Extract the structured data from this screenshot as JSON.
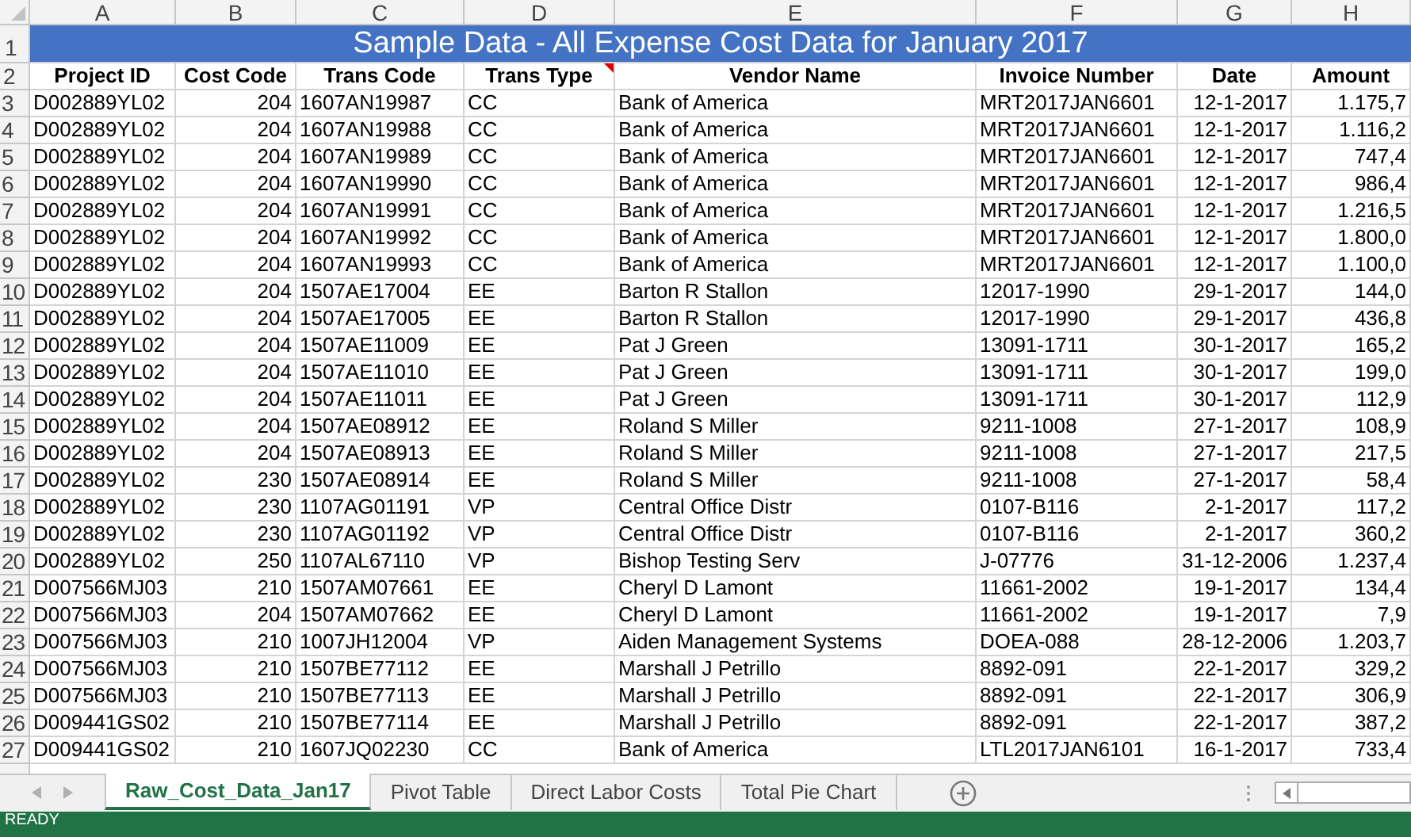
{
  "columns": [
    {
      "letter": "A",
      "heading": "Project ID",
      "comment": false
    },
    {
      "letter": "B",
      "heading": "Cost Code",
      "comment": false
    },
    {
      "letter": "C",
      "heading": "Trans Code",
      "comment": false
    },
    {
      "letter": "D",
      "heading": "Trans Type",
      "comment": true
    },
    {
      "letter": "E",
      "heading": "Vendor Name",
      "comment": false
    },
    {
      "letter": "F",
      "heading": "Invoice Number",
      "comment": false
    },
    {
      "letter": "G",
      "heading": "Date",
      "comment": false
    },
    {
      "letter": "H",
      "heading": "Amount",
      "comment": false
    }
  ],
  "title_row": {
    "number": "1",
    "title": "Sample Data - All Expense Cost Data for January 2017"
  },
  "heading_row_number": "2",
  "rows": [
    {
      "number": "3",
      "cells": [
        "D002889YL02",
        "204",
        "1607AN19987",
        "CC",
        "Bank of America",
        "MRT2017JAN6601",
        "12-1-2017",
        "1.175,7"
      ]
    },
    {
      "number": "4",
      "cells": [
        "D002889YL02",
        "204",
        "1607AN19988",
        "CC",
        "Bank of America",
        "MRT2017JAN6601",
        "12-1-2017",
        "1.116,2"
      ]
    },
    {
      "number": "5",
      "cells": [
        "D002889YL02",
        "204",
        "1607AN19989",
        "CC",
        "Bank of America",
        "MRT2017JAN6601",
        "12-1-2017",
        "747,4"
      ]
    },
    {
      "number": "6",
      "cells": [
        "D002889YL02",
        "204",
        "1607AN19990",
        "CC",
        "Bank of America",
        "MRT2017JAN6601",
        "12-1-2017",
        "986,4"
      ]
    },
    {
      "number": "7",
      "cells": [
        "D002889YL02",
        "204",
        "1607AN19991",
        "CC",
        "Bank of America",
        "MRT2017JAN6601",
        "12-1-2017",
        "1.216,5"
      ]
    },
    {
      "number": "8",
      "cells": [
        "D002889YL02",
        "204",
        "1607AN19992",
        "CC",
        "Bank of America",
        "MRT2017JAN6601",
        "12-1-2017",
        "1.800,0"
      ]
    },
    {
      "number": "9",
      "cells": [
        "D002889YL02",
        "204",
        "1607AN19993",
        "CC",
        "Bank of America",
        "MRT2017JAN6601",
        "12-1-2017",
        "1.100,0"
      ]
    },
    {
      "number": "10",
      "cells": [
        "D002889YL02",
        "204",
        "1507AE17004",
        "EE",
        "Barton R Stallon",
        "12017-1990",
        "29-1-2017",
        "144,0"
      ]
    },
    {
      "number": "11",
      "cells": [
        "D002889YL02",
        "204",
        "1507AE17005",
        "EE",
        "Barton R Stallon",
        "12017-1990",
        "29-1-2017",
        "436,8"
      ]
    },
    {
      "number": "12",
      "cells": [
        "D002889YL02",
        "204",
        "1507AE11009",
        "EE",
        "Pat J Green",
        "13091-1711",
        "30-1-2017",
        "165,2"
      ]
    },
    {
      "number": "13",
      "cells": [
        "D002889YL02",
        "204",
        "1507AE11010",
        "EE",
        "Pat J Green",
        "13091-1711",
        "30-1-2017",
        "199,0"
      ]
    },
    {
      "number": "14",
      "cells": [
        "D002889YL02",
        "204",
        "1507AE11011",
        "EE",
        "Pat J Green",
        "13091-1711",
        "30-1-2017",
        "112,9"
      ]
    },
    {
      "number": "15",
      "cells": [
        "D002889YL02",
        "204",
        "1507AE08912",
        "EE",
        "Roland S Miller",
        "9211-1008",
        "27-1-2017",
        "108,9"
      ]
    },
    {
      "number": "16",
      "cells": [
        "D002889YL02",
        "204",
        "1507AE08913",
        "EE",
        "Roland S Miller",
        "9211-1008",
        "27-1-2017",
        "217,5"
      ]
    },
    {
      "number": "17",
      "cells": [
        "D002889YL02",
        "230",
        "1507AE08914",
        "EE",
        "Roland S Miller",
        "9211-1008",
        "27-1-2017",
        "58,4"
      ]
    },
    {
      "number": "18",
      "cells": [
        "D002889YL02",
        "230",
        "1107AG01191",
        "VP",
        "Central Office Distr",
        "0107-B116",
        "2-1-2017",
        "117,2"
      ]
    },
    {
      "number": "19",
      "cells": [
        "D002889YL02",
        "230",
        "1107AG01192",
        "VP",
        "Central Office Distr",
        "0107-B116",
        "2-1-2017",
        "360,2"
      ]
    },
    {
      "number": "20",
      "cells": [
        "D002889YL02",
        "250",
        "1107AL67110",
        "VP",
        "Bishop Testing Serv",
        "J-07776",
        "31-12-2006",
        "1.237,4"
      ]
    },
    {
      "number": "21",
      "cells": [
        "D007566MJ03",
        "210",
        "1507AM07661",
        "EE",
        "Cheryl D Lamont",
        "11661-2002",
        "19-1-2017",
        "134,4"
      ]
    },
    {
      "number": "22",
      "cells": [
        "D007566MJ03",
        "204",
        "1507AM07662",
        "EE",
        "Cheryl D Lamont",
        "11661-2002",
        "19-1-2017",
        "7,9"
      ]
    },
    {
      "number": "23",
      "cells": [
        "D007566MJ03",
        "210",
        "1007JH12004",
        "VP",
        "Aiden Management Systems",
        "DOEA-088",
        "28-12-2006",
        "1.203,7"
      ]
    },
    {
      "number": "24",
      "cells": [
        "D007566MJ03",
        "210",
        "1507BE77112",
        "EE",
        "Marshall J Petrillo",
        "8892-091",
        "22-1-2017",
        "329,2"
      ]
    },
    {
      "number": "25",
      "cells": [
        "D007566MJ03",
        "210",
        "1507BE77113",
        "EE",
        "Marshall J Petrillo",
        "8892-091",
        "22-1-2017",
        "306,9"
      ]
    },
    {
      "number": "26",
      "cells": [
        "D009441GS02",
        "210",
        "1507BE77114",
        "EE",
        "Marshall J Petrillo",
        "8892-091",
        "22-1-2017",
        "387,2"
      ]
    },
    {
      "number": "27",
      "cells": [
        "D009441GS02",
        "210",
        "1607JQ02230",
        "CC",
        "Bank of America",
        "LTL2017JAN6101",
        "16-1-2017",
        "733,4"
      ]
    }
  ],
  "sheet_tabs": [
    {
      "label": "Raw_Cost_Data_Jan17",
      "selected": true
    },
    {
      "label": "Pivot Table",
      "selected": false
    },
    {
      "label": "Direct Labor Costs",
      "selected": false
    },
    {
      "label": "Total Pie Chart",
      "selected": false
    }
  ],
  "status_bar": {
    "mode": "READY"
  }
}
